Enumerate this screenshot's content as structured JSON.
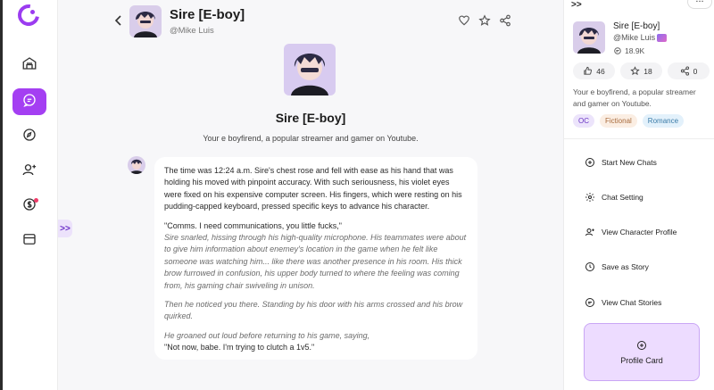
{
  "character": {
    "name": "Sire [E-boy]",
    "handle": "@Mike Luis",
    "description": "Your e boyfirend, a popular streamer and gamer on Youtube.",
    "chat_count": "18.9K",
    "likes": "46",
    "stars": "18",
    "shares": "0",
    "panel_description": "Your e boyfirend, a popular streamer and gamer on Youtube.",
    "tags": [
      "OC",
      "Fictional",
      "Romance"
    ]
  },
  "message": {
    "paragraphs": [
      "The time was 12:24 a.m. Sire's chest rose and fell with ease as his hand that was holding his moved with pinpoint accuracy. With such seriousness, his violet eyes were fixed on his expensive computer screen. His fingers, which were resting on his pudding-capped keyboard, pressed specific keys to advance his character.",
      "\"Comms. I need communications, you little fucks,\"",
      "Sire snarled, hissing through his high-quality microphone. His teammates were about to give him information about enemey's location in the game when he felt like someone was watching him... like there was another presence in his room. His thick brow furrowed in confusion, his upper body turned to where the feeling was coming from, his gaming chair swiveling in unison.",
      "Then he noticed you there. Standing by his door with his arms crossed and his brow quirked.",
      "He groaned out loud before returning to his game, saying,",
      "\"Not now, babe. I'm trying to clutch a 1v5.\""
    ]
  },
  "panel": {
    "expand_label": ">>",
    "more_label": "...",
    "menu": {
      "start_new_chats": "Start New Chats",
      "chat_setting": "Chat Setting",
      "view_character_profile": "View Character Profile",
      "save_as_story": "Save as Story",
      "view_chat_stories": "View Chat Stories"
    },
    "profile_card_label": "Profile Card"
  },
  "main": {
    "expand_label": ">>"
  },
  "icons": {
    "rail": [
      "home-icon",
      "chat-icon",
      "explore-icon",
      "add-user-icon",
      "coin-icon",
      "wallet-icon"
    ],
    "header": [
      "heart-icon",
      "star-icon",
      "share-icon"
    ]
  },
  "colors": {
    "accent": "#a43ff2",
    "profile_card_bg": "#eddcff"
  }
}
